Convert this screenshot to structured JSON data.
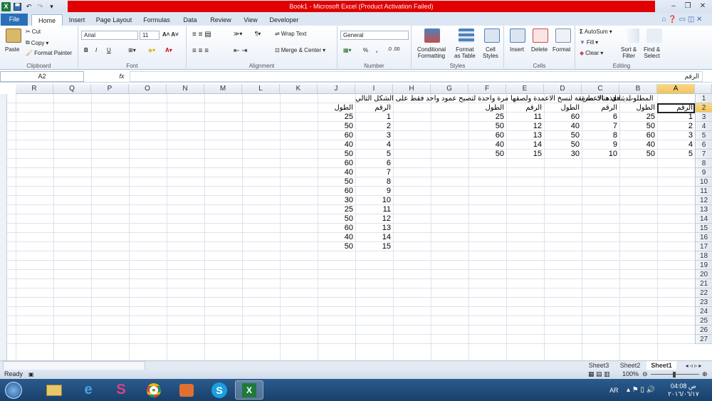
{
  "window": {
    "title": "Book1  -  Microsoft Excel (Product Activation Failed)"
  },
  "tabs": [
    "File",
    "Home",
    "Insert",
    "Page Layout",
    "Formulas",
    "Data",
    "Review",
    "View",
    "Developer"
  ],
  "ribbon": {
    "clipboard": {
      "paste": "Paste",
      "cut": "Cut",
      "copy": "Copy",
      "format_painter": "Format Painter",
      "label": "Clipboard"
    },
    "font": {
      "name": "Arial",
      "size": "11",
      "label": "Font",
      "bold": "B",
      "italic": "I",
      "underline": "U"
    },
    "alignment": {
      "wrap_text": "Wrap Text",
      "merge_center": "Merge & Center",
      "label": "Alignment"
    },
    "number": {
      "format": "General",
      "percent": "%",
      "comma": ",",
      "label": "Number"
    },
    "styles": {
      "conditional": "Conditional",
      "conditional2": "Formatting",
      "format_as": "Format",
      "format_as2": "as Table",
      "cell": "Cell",
      "cell2": "Styles",
      "label": "Styles"
    },
    "cells": {
      "insert": "Insert",
      "delete": "Delete",
      "format": "Format",
      "label": "Cells"
    },
    "editing": {
      "autosum": "AutoSum",
      "fill": "Fill",
      "clear": "Clear",
      "sort": "Sort &",
      "sort2": "Filter",
      "find": "Find &",
      "find2": "Select",
      "label": "Editing"
    }
  },
  "formula_bar": {
    "name_box": "A2",
    "fx": "fx",
    "content": "الرقم"
  },
  "columns": [
    "A",
    "B",
    "C",
    "D",
    "E",
    "F",
    "G",
    "H",
    "I",
    "J",
    "K",
    "L",
    "M",
    "N",
    "O",
    "P",
    "Q",
    "R"
  ],
  "rows": [
    "1",
    "2",
    "3",
    "4",
    "5",
    "6",
    "7",
    "8",
    "9",
    "10",
    "11",
    "12",
    "13",
    "14",
    "15",
    "16",
    "17",
    "18",
    "19",
    "20",
    "21",
    "22",
    "23",
    "24",
    "25",
    "26",
    "27"
  ],
  "cells": {
    "note_left": "لدينا هذه الاعمدة",
    "note_right": "المطلوب : هل هناك طريقة لنسخ الاعمدة ولصقها مرة  واحدة لتصبح عمود واحد فقط على الشكل التالي",
    "hdr_num": "الرقم",
    "hdr_len": "الطول",
    "A": [
      "1",
      "2",
      "3",
      "4",
      "5"
    ],
    "B": [
      "25",
      "50",
      "60",
      "40",
      "50"
    ],
    "C": [
      "6",
      "7",
      "8",
      "9",
      "10"
    ],
    "D": [
      "60",
      "40",
      "50",
      "50",
      "30"
    ],
    "E": [
      "11",
      "12",
      "13",
      "14",
      "15"
    ],
    "F": [
      "25",
      "50",
      "60",
      "40",
      "50"
    ],
    "I": [
      "1",
      "2",
      "3",
      "4",
      "5",
      "6",
      "7",
      "8",
      "9",
      "10",
      "11",
      "12",
      "13",
      "14",
      "15"
    ],
    "J": [
      "25",
      "50",
      "60",
      "40",
      "50",
      "60",
      "40",
      "50",
      "60",
      "30",
      "25",
      "50",
      "60",
      "40",
      "50"
    ]
  },
  "sheets": [
    "Sheet3",
    "Sheet2",
    "Sheet1"
  ],
  "status": {
    "ready": "Ready",
    "zoom": "100%"
  },
  "tray": {
    "lang": "AR",
    "time": "04:08 ص",
    "date": "٢٠١٦/٠٦/١٧"
  }
}
